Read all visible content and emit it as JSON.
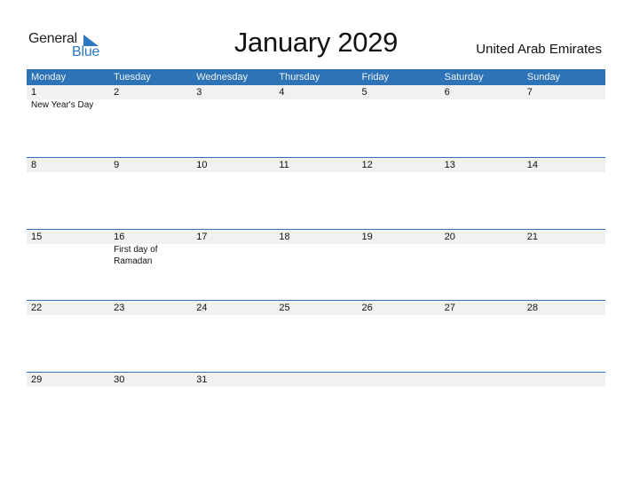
{
  "logo": {
    "general": "General",
    "blue": "Blue"
  },
  "title": "January 2029",
  "country": "United Arab Emirates",
  "colors": {
    "accent": "#2e73b5",
    "strip": "#f1f1f1"
  },
  "days": [
    "Monday",
    "Tuesday",
    "Wednesday",
    "Thursday",
    "Friday",
    "Saturday",
    "Sunday"
  ],
  "weeks": [
    {
      "dates": [
        "1",
        "2",
        "3",
        "4",
        "5",
        "6",
        "7"
      ],
      "events": [
        "New Year's Day",
        "",
        "",
        "",
        "",
        "",
        ""
      ]
    },
    {
      "dates": [
        "8",
        "9",
        "10",
        "11",
        "12",
        "13",
        "14"
      ],
      "events": [
        "",
        "",
        "",
        "",
        "",
        "",
        ""
      ]
    },
    {
      "dates": [
        "15",
        "16",
        "17",
        "18",
        "19",
        "20",
        "21"
      ],
      "events": [
        "",
        "First day of Ramadan",
        "",
        "",
        "",
        "",
        ""
      ]
    },
    {
      "dates": [
        "22",
        "23",
        "24",
        "25",
        "26",
        "27",
        "28"
      ],
      "events": [
        "",
        "",
        "",
        "",
        "",
        "",
        ""
      ]
    },
    {
      "dates": [
        "29",
        "30",
        "31",
        "",
        "",
        "",
        ""
      ],
      "events": [
        "",
        "",
        "",
        "",
        "",
        "",
        ""
      ]
    }
  ]
}
